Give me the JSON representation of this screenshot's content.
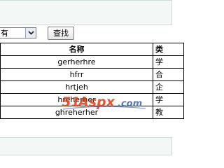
{
  "filter": {
    "selected_value": "有",
    "search_label": "查找"
  },
  "table": {
    "headers": [
      "名称",
      "类"
    ],
    "rows": [
      {
        "name": "gerherhre",
        "type": "学"
      },
      {
        "name": "hfrr",
        "type": "合"
      },
      {
        "name": "hrtjeh",
        "type": "企"
      },
      {
        "name": "hreherher",
        "type": "学"
      },
      {
        "name": "ghreherher",
        "type": "教"
      }
    ]
  },
  "watermark": {
    "text": "51aspx.com",
    "colors": {
      "primary": "#e8380d",
      "secondary": "#3a62ad"
    }
  },
  "icons": {
    "dropdown": "chevron-down-icon"
  }
}
